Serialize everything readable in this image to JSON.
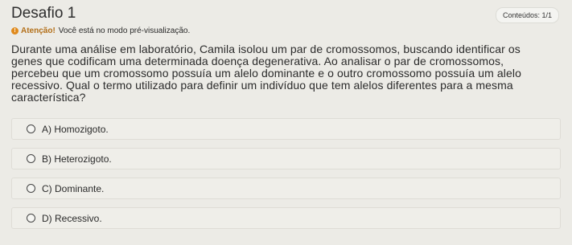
{
  "header": {
    "title": "Desafio 1",
    "badge": "Conteúdos: 1/1"
  },
  "notice": {
    "icon": "alert-icon",
    "strong": "Atenção!",
    "text": "Você está no modo pré-visualização."
  },
  "question": {
    "text": "Durante uma análise em laboratório, Camila isolou um par de cromossomos, buscando identificar os genes que codificam uma determinada doença degenerativa. Ao analisar o par de cromossomos, percebeu que um cromossomo possuía um alelo dominante e o outro cromossomo possuía um alelo recessivo. Qual o termo utilizado para definir um indivíduo que tem alelos diferentes para a mesma característica?"
  },
  "options": [
    {
      "label": "A) Homozigoto."
    },
    {
      "label": "B) Heterozigoto."
    },
    {
      "label": "C) Dominante."
    },
    {
      "label": "D) Recessivo."
    }
  ],
  "colors": {
    "background": "#ecebe6",
    "accent": "#e08a1c"
  }
}
